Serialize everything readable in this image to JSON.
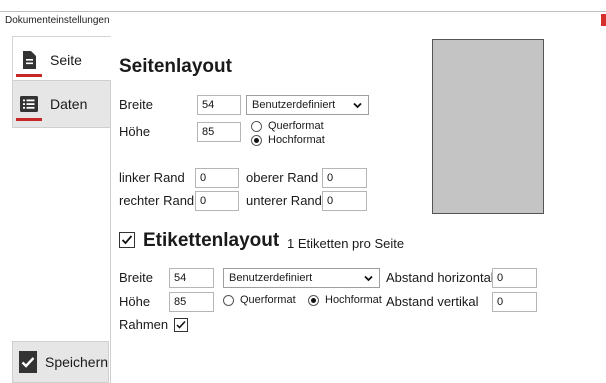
{
  "window": {
    "title": "Dokumenteinstellungen"
  },
  "sidebar": {
    "items": [
      {
        "label": "Seite",
        "icon": "document-icon"
      },
      {
        "label": "Daten",
        "icon": "list-icon"
      }
    ],
    "save_label": "Speichern",
    "accent": "#c62828"
  },
  "page_layout": {
    "title": "Seitenlayout",
    "width_label": "Breite",
    "width_value": "54",
    "height_label": "Höhe",
    "height_value": "85",
    "format_select": "Benutzerdefiniert",
    "orientation": {
      "landscape_label": "Querformat",
      "portrait_label": "Hochformat",
      "selected": "Hochformat"
    },
    "margins": {
      "left_label": "linker Rand",
      "left_value": "0",
      "top_label": "oberer Rand",
      "top_value": "0",
      "right_label": "rechter Rand",
      "right_value": "0",
      "bottom_label": "unterer Rand",
      "bottom_value": "0"
    }
  },
  "label_layout": {
    "enabled": true,
    "title": "Etikettenlayout",
    "count_text": "1 Etiketten pro Seite",
    "width_label": "Breite",
    "width_value": "54",
    "height_label": "Höhe",
    "height_value": "85",
    "format_select": "Benutzerdefiniert",
    "orientation": {
      "landscape_label": "Querformat",
      "portrait_label": "Hochformat",
      "selected": "Hochformat"
    },
    "spacing_h_label": "Abstand horizontal",
    "spacing_h_value": "0",
    "spacing_v_label": "Abstand vertikal",
    "spacing_v_value": "0",
    "frame_label": "Rahmen",
    "frame_checked": true
  }
}
